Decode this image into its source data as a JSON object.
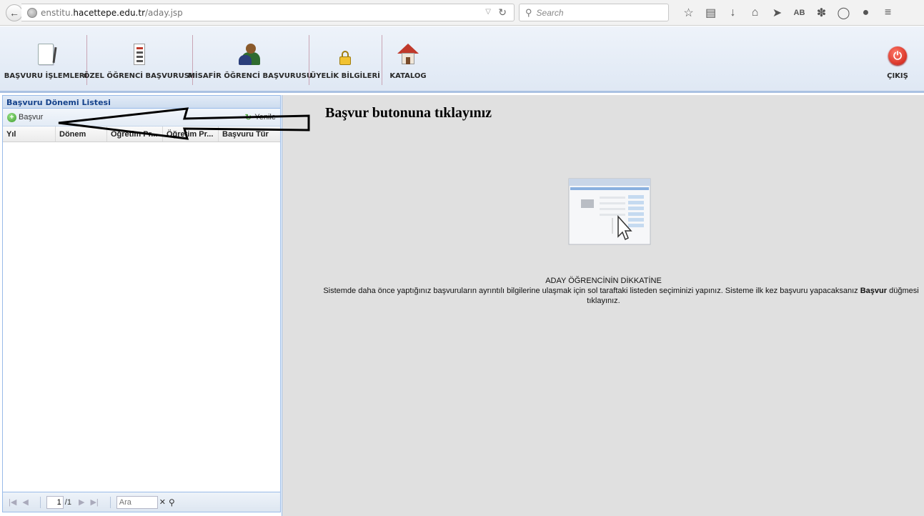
{
  "browser": {
    "url_prefix": "enstitu.",
    "url_domain": "hacettepe.edu.tr",
    "url_path": "/aday.jsp",
    "search_placeholder": "Search",
    "reader_label": "AB"
  },
  "menu": {
    "items": [
      {
        "label": "BAŞVURU İŞLEMLERİ",
        "icon": "document-icon"
      },
      {
        "label": "ÖZEL ÖĞRENCİ BAŞVURUSU",
        "icon": "form-icon"
      },
      {
        "label": "MİSAFİR ÖĞRENCİ BAŞVURUSU",
        "icon": "users-icon"
      },
      {
        "label": "ÜYELİK BİLGİLERİ",
        "icon": "lock-icon"
      },
      {
        "label": "KATALOG",
        "icon": "house-icon"
      }
    ],
    "logout_label": "ÇIKIŞ"
  },
  "left_panel": {
    "title": "Başvuru Dönemi Listesi",
    "apply_button": "Başvur",
    "refresh_button": "Yenile",
    "columns": [
      "Yıl",
      "Dönem",
      "Öğretim Pr...",
      "Öğretim Pr...",
      "Başvuru Tür"
    ],
    "pager": {
      "page_value": "1",
      "page_of": "/1",
      "search_placeholder": "Ara"
    }
  },
  "right_panel": {
    "annotation": "Başvur butonuna tıklayınız",
    "notice_title": "ADAY ÖĞRENCİNİN DİKKATİNE",
    "notice_body_1": "Sistemde daha önce yaptığınız başvuruların ayrıntılı bilgilerine ulaşmak için sol taraftaki listeden seçiminizi yapınız. Sisteme ilk kez başvuru yapacaksanız ",
    "notice_bold": "Başvur",
    "notice_body_2": " düğmesi",
    "notice_body_3": "tıklayınız."
  }
}
